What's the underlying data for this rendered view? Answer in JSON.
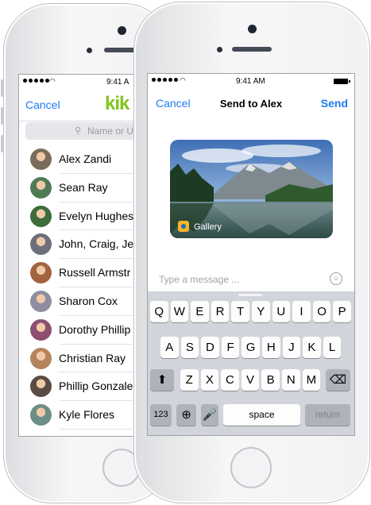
{
  "back_phone": {
    "status": {
      "time": "9:41 A"
    },
    "nav": {
      "cancel": "Cancel",
      "logo": "kik"
    },
    "search": {
      "icon": "search-icon",
      "placeholder": "Name or U"
    },
    "contacts": [
      {
        "name": "Alex Zandi",
        "color": "#7b6b5a"
      },
      {
        "name": "Sean Ray",
        "color": "#4f7a54"
      },
      {
        "name": "Evelyn Hughes",
        "color": "#3c6d3a"
      },
      {
        "name": "John, Craig, Je",
        "color": "#6d6f7a"
      },
      {
        "name": "Russell Armstr",
        "color": "#a2643f"
      },
      {
        "name": "Sharon Cox",
        "color": "#8e8ea0"
      },
      {
        "name": "Dorothy Phillip",
        "color": "#8c4f6f"
      },
      {
        "name": "Christian Ray",
        "color": "#b4845c"
      },
      {
        "name": "Phillip Gonzale",
        "color": "#5b4b45"
      },
      {
        "name": "Kyle Flores",
        "color": "#6c8e86"
      }
    ]
  },
  "front_phone": {
    "status": {
      "time": "9:41 AM"
    },
    "nav": {
      "cancel": "Cancel",
      "title": "Send to Alex",
      "send": "Send"
    },
    "attachment": {
      "label": "Gallery",
      "icon": "gallery-icon"
    },
    "message": {
      "placeholder": "Type a message ...",
      "emoji_icon": "emoji-icon"
    },
    "keyboard": {
      "row1": [
        "Q",
        "W",
        "E",
        "R",
        "T",
        "Y",
        "U",
        "I",
        "O",
        "P"
      ],
      "row2": [
        "A",
        "S",
        "D",
        "F",
        "G",
        "H",
        "J",
        "K",
        "L"
      ],
      "row3": [
        "Z",
        "X",
        "C",
        "V",
        "B",
        "N",
        "M"
      ],
      "numbers": "123",
      "globe_icon": "globe-icon",
      "mic_icon": "microphone-icon",
      "space": "space",
      "return": "return",
      "shift_icon": "shift-icon",
      "delete_icon": "backspace-icon"
    }
  },
  "colors": {
    "accent": "#1e7cf2",
    "kik_green": "#82c421"
  }
}
